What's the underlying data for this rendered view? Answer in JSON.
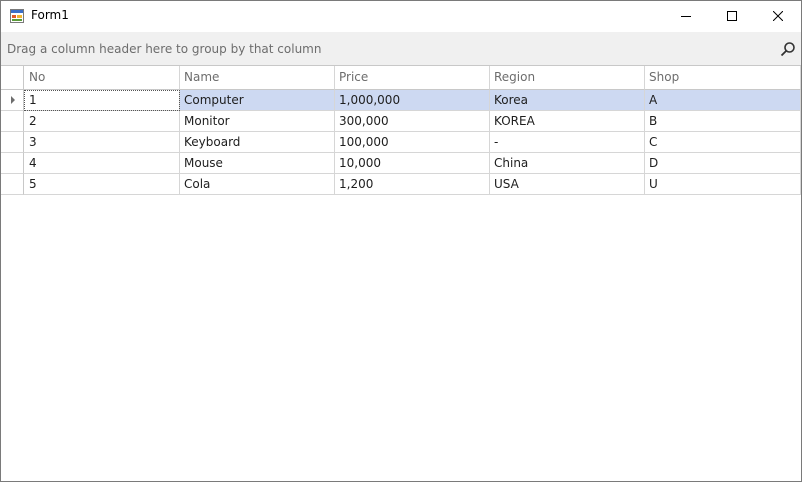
{
  "window": {
    "title": "Form1",
    "icon": "form-app-icon",
    "controls": [
      "minimize-icon",
      "maximize-icon",
      "close-icon"
    ]
  },
  "group_panel": {
    "text": "Drag a column header here to group by that column",
    "search_icon": "search-icon"
  },
  "grid": {
    "columns": [
      "No",
      "Name",
      "Price",
      "Region",
      "Shop"
    ],
    "rows": [
      {
        "no": "1",
        "name": "Computer",
        "price": "1,000,000",
        "region": "Korea",
        "shop": "A",
        "selected": true
      },
      {
        "no": "2",
        "name": "Monitor",
        "price": "300,000",
        "region": "KOREA",
        "shop": "B"
      },
      {
        "no": "3",
        "name": "Keyboard",
        "price": "100,000",
        "region": "-",
        "shop": "C"
      },
      {
        "no": "4",
        "name": "Mouse",
        "price": "10,000",
        "region": "China",
        "shop": "D"
      },
      {
        "no": "5",
        "name": "Cola",
        "price": "1,200",
        "region": "USA",
        "shop": "U"
      }
    ]
  },
  "colors": {
    "selection": "#cdd9f2",
    "group_panel_bg": "#f0f0f0",
    "header_text": "#6d6d6d",
    "grid_line": "#d6d6d6"
  }
}
